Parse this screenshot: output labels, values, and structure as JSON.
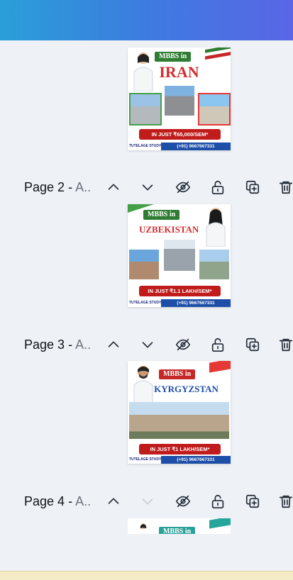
{
  "pages": [
    {
      "thumb": {
        "badge": "MBBS in",
        "country": "IRAN",
        "price": "IN JUST ₹65,000/SEM*",
        "brand": "TUTELAGE STUDY",
        "phone": "(+91) 9667667331"
      }
    },
    {
      "num": "Page 2",
      "sep": " - ",
      "title": "A..",
      "thumb": {
        "badge": "MBBS in",
        "country": "UZBEKISTAN",
        "price": "IN JUST ₹1.1 LAKH/SEM*",
        "brand": "TUTELAGE STUDY",
        "phone": "(+91) 9667667331"
      }
    },
    {
      "num": "Page 3",
      "sep": " - ",
      "title": "A..",
      "thumb": {
        "badge": "MBBS in",
        "country": "KYRGYZSTAN",
        "price": "IN JUST ₹1 LAKH/SEM*",
        "brand": "TUTELAGE STUDY",
        "phone": "(+91) 9667667331"
      }
    },
    {
      "num": "Page 4",
      "sep": " - ",
      "title": "A..",
      "thumb": {
        "badge": "MBBS in"
      }
    }
  ],
  "controls": [
    "chevron-up-icon",
    "chevron-down-icon",
    "eye-off-icon",
    "unlock-icon",
    "duplicate-icon",
    "trash-icon"
  ],
  "colors": {
    "accent_start": "#2a9fd8",
    "accent_end": "#5a66e6",
    "background": "#eef1f5"
  }
}
